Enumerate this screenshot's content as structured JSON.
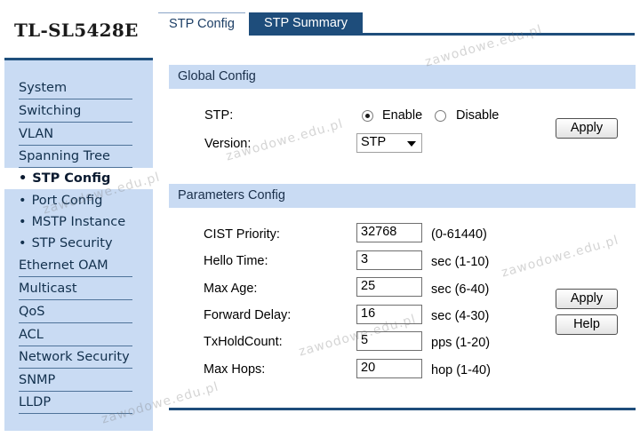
{
  "brand": "TL-SL5428E",
  "sidebar": {
    "items": [
      {
        "label": "System",
        "type": "main"
      },
      {
        "label": "Switching",
        "type": "main"
      },
      {
        "label": "VLAN",
        "type": "main"
      },
      {
        "label": "Spanning Tree",
        "type": "main"
      },
      {
        "label": "STP Config",
        "type": "sub",
        "active": true
      },
      {
        "label": "Port Config",
        "type": "sub"
      },
      {
        "label": "MSTP Instance",
        "type": "sub"
      },
      {
        "label": "STP Security",
        "type": "sub"
      },
      {
        "label": "Ethernet OAM",
        "type": "main"
      },
      {
        "label": "Multicast",
        "type": "main"
      },
      {
        "label": "QoS",
        "type": "main"
      },
      {
        "label": "ACL",
        "type": "main"
      },
      {
        "label": "Network Security",
        "type": "main"
      },
      {
        "label": "SNMP",
        "type": "main"
      },
      {
        "label": "LLDP",
        "type": "main"
      }
    ],
    "bullet": "•"
  },
  "tabs": [
    {
      "label": "STP Config",
      "active": true
    },
    {
      "label": "STP Summary",
      "active": false
    }
  ],
  "global_config": {
    "title": "Global Config",
    "stp_label": "STP:",
    "enable_label": "Enable",
    "disable_label": "Disable",
    "stp_selected": "Enable",
    "version_label": "Version:",
    "version_value": "STP",
    "apply_label": "Apply"
  },
  "parameters_config": {
    "title": "Parameters Config",
    "rows": [
      {
        "label": "CIST Priority:",
        "value": "32768",
        "range": "(0-61440)"
      },
      {
        "label": "Hello Time:",
        "value": "3",
        "range": "sec (1-10)"
      },
      {
        "label": "Max Age:",
        "value": "25",
        "range": "sec (6-40)"
      },
      {
        "label": "Forward Delay:",
        "value": "16",
        "range": "sec (4-30)"
      },
      {
        "label": "TxHoldCount:",
        "value": "5",
        "range": "pps (1-20)"
      },
      {
        "label": "Max Hops:",
        "value": "20",
        "range": "hop (1-40)"
      }
    ],
    "apply_label": "Apply",
    "help_label": "Help"
  },
  "watermark": "zawodowe.edu.pl",
  "colors": {
    "sidebar_bg": "#c9dbf3",
    "header_bar": "#1e4d7b",
    "section_bg": "#c9dbf3"
  }
}
